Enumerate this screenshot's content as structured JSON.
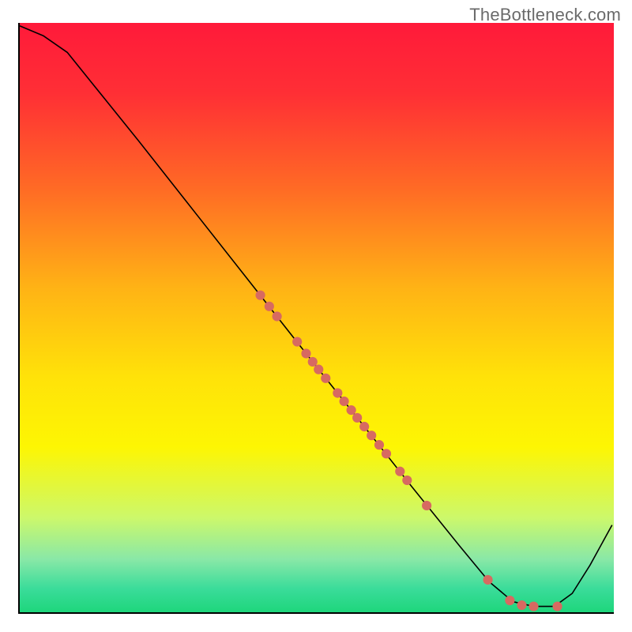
{
  "watermark_text": "TheBottleneck.com",
  "chart_data": {
    "type": "line",
    "title": "",
    "xlabel": "",
    "ylabel": "",
    "xlim": [
      0,
      100
    ],
    "ylim": [
      0,
      100
    ],
    "grid": false,
    "legend": false,
    "gradient_background": {
      "type": "vertical",
      "stops": [
        {
          "pct": 0,
          "color": "#ff1a3a"
        },
        {
          "pct": 12,
          "color": "#ff2f35"
        },
        {
          "pct": 28,
          "color": "#ff6a25"
        },
        {
          "pct": 45,
          "color": "#ffb315"
        },
        {
          "pct": 60,
          "color": "#ffe209"
        },
        {
          "pct": 72,
          "color": "#fdf603"
        },
        {
          "pct": 84,
          "color": "#ccf86b"
        },
        {
          "pct": 91,
          "color": "#89e8a7"
        },
        {
          "pct": 96,
          "color": "#3adc9a"
        },
        {
          "pct": 100,
          "color": "#1ed67c"
        }
      ]
    },
    "series": [
      {
        "name": "bottleneck-curve",
        "stroke": "#000000",
        "stroke_width": 1.6,
        "x": [
          0,
          4,
          8,
          12,
          20,
          30,
          40,
          50,
          58,
          66,
          74,
          79,
          83,
          86.5,
          90,
          93,
          96,
          99.7
        ],
        "y": [
          99.5,
          97.8,
          95,
          90,
          80,
          67.2,
          54.4,
          41.6,
          31.5,
          21.3,
          11.3,
          5.2,
          1.8,
          1.0,
          1.0,
          3.2,
          8.0,
          14.8
        ]
      }
    ],
    "scatter_points": {
      "name": "sampled-points-on-curve",
      "color": "#d76a61",
      "radius": 6.1,
      "x": [
        40.5,
        42,
        43.3,
        46.7,
        48.2,
        49.3,
        50.3,
        51.5,
        53.5,
        54.6,
        55.8,
        56.8,
        58,
        59.2,
        60.5,
        61.7,
        64,
        65.2,
        68.5,
        78.8,
        82.5,
        84.5,
        86.5,
        90.5
      ],
      "y": [
        53.8,
        51.9,
        50.2,
        45.9,
        43.9,
        42.5,
        41.2,
        39.7,
        37.2,
        35.8,
        34.3,
        33,
        31.5,
        30,
        28.4,
        26.9,
        23.9,
        22.4,
        18.1,
        5.5,
        2.0,
        1.2,
        1.0,
        1.0
      ]
    }
  }
}
